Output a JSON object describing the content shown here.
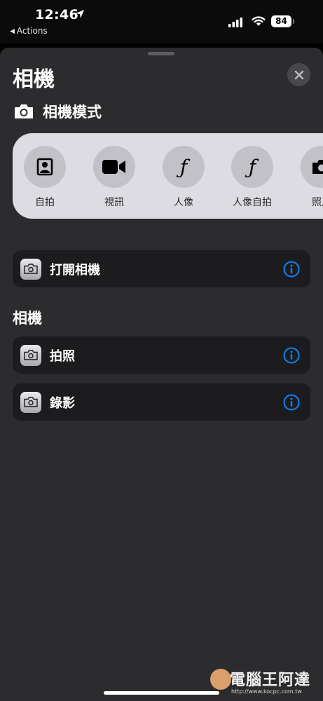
{
  "status_bar": {
    "time": "12:46",
    "back_label": "Actions",
    "battery": "84"
  },
  "sheet": {
    "title": "相機",
    "mode_header": "相機模式",
    "modes": [
      {
        "label": "自拍",
        "icon": "selfie-portrait-icon"
      },
      {
        "label": "視訊",
        "icon": "video-icon"
      },
      {
        "label": "人像",
        "icon": "aperture-f-icon",
        "glyph": "ƒ"
      },
      {
        "label": "人像自拍",
        "icon": "aperture-f-icon",
        "glyph": "ƒ"
      },
      {
        "label": "照片",
        "icon": "camera-icon"
      }
    ],
    "open_camera": "打開相機",
    "section_title": "相機",
    "actions": [
      {
        "label": "拍照"
      },
      {
        "label": "錄影"
      }
    ]
  },
  "watermark": {
    "text": "電腦王阿達",
    "url": "http://www.kocpc.com.tw"
  },
  "colors": {
    "sheet_bg": "#2c2c2e",
    "row_bg": "#1c1c1e",
    "picker_bg": "#dedce3",
    "info_blue": "#0a84ff"
  }
}
